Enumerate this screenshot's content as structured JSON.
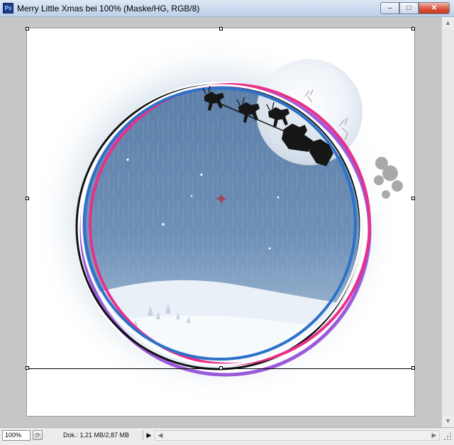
{
  "window": {
    "title": "Merry Little Xmas bei 100% (Maske/HG, RGB/8)",
    "app_icon": "Ps",
    "controls": {
      "minimize": "–",
      "maximize": "□",
      "close": "✕"
    }
  },
  "canvas": {
    "background": "#ffffff",
    "artwork_colors": {
      "sky": "#4f74a0",
      "ring_purple": "#9b5bd9",
      "ring_pink": "#ea2f87",
      "ring_blue": "#2c72c8",
      "ring_black": "#111111"
    }
  },
  "statusbar": {
    "zoom": "100%",
    "doc_info": "Dok.: 1,21 MB/2,87 MB",
    "play_icon": "▶",
    "scroll_left_icon": "◀",
    "scroll_right_icon": "▶"
  },
  "vscroll": {
    "up_icon": "▲",
    "down_icon": "▼"
  }
}
